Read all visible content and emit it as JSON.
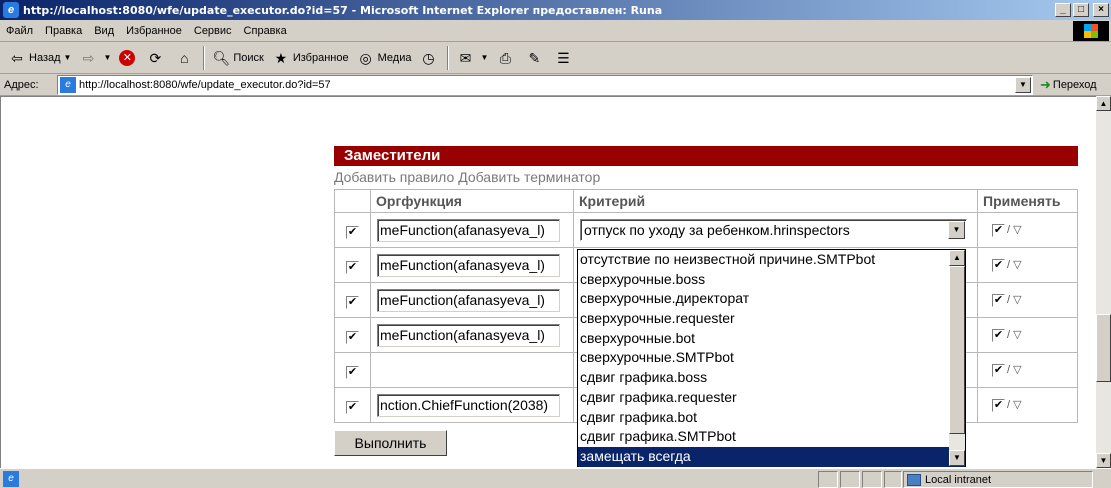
{
  "window": {
    "title": "http://localhost:8080/wfe/update_executor.do?id=57 - Microsoft Internet Explorer предоставлен: Runa",
    "min_label": "_",
    "max_label": "□",
    "close_label": "×"
  },
  "menu": [
    "Файл",
    "Правка",
    "Вид",
    "Избранное",
    "Сервис",
    "Справка"
  ],
  "toolbar": {
    "back": "Назад",
    "search": "Поиск",
    "favorites": "Избранное",
    "media": "Медиа"
  },
  "address": {
    "label": "Адрес:",
    "url": "http://localhost:8080/wfe/update_executor.do?id=57",
    "go": "Переход"
  },
  "page": {
    "section_title": "Заместители",
    "add_rule": "Добавить правило",
    "add_terminator": "Добавить терминатор",
    "columns": [
      "Оргфункция",
      "Критерий",
      "Применять"
    ],
    "rows": [
      {
        "orgfunction": "meFunction(afanasyeva_l)"
      },
      {
        "orgfunction": "meFunction(afanasyeva_l)"
      },
      {
        "orgfunction": "meFunction(afanasyeva_l)"
      },
      {
        "orgfunction": "meFunction(afanasyeva_l)"
      },
      {
        "orgfunction": ""
      },
      {
        "orgfunction": "nction.ChiefFunction(2038)"
      }
    ],
    "selected_criterion": "отпуск по уходу за ребенком.hrinspectors",
    "options": [
      "отсутствие по неизвестной причине.SMTPbot",
      "сверхурочные.boss",
      "сверхурочные.директорат",
      "сверхурочные.requester",
      "сверхурочные.bot",
      "сверхурочные.SMTPbot",
      "сдвиг графика.boss",
      "сдвиг графика.requester",
      "сдвиг графика.bot",
      "сдвиг графика.SMTPbot",
      "замещать всегда"
    ],
    "highlighted_option": "замещать всегда",
    "apply_mark": "/ ▽",
    "submit": "Выполнить"
  },
  "status": {
    "zone": "Local intranet"
  }
}
